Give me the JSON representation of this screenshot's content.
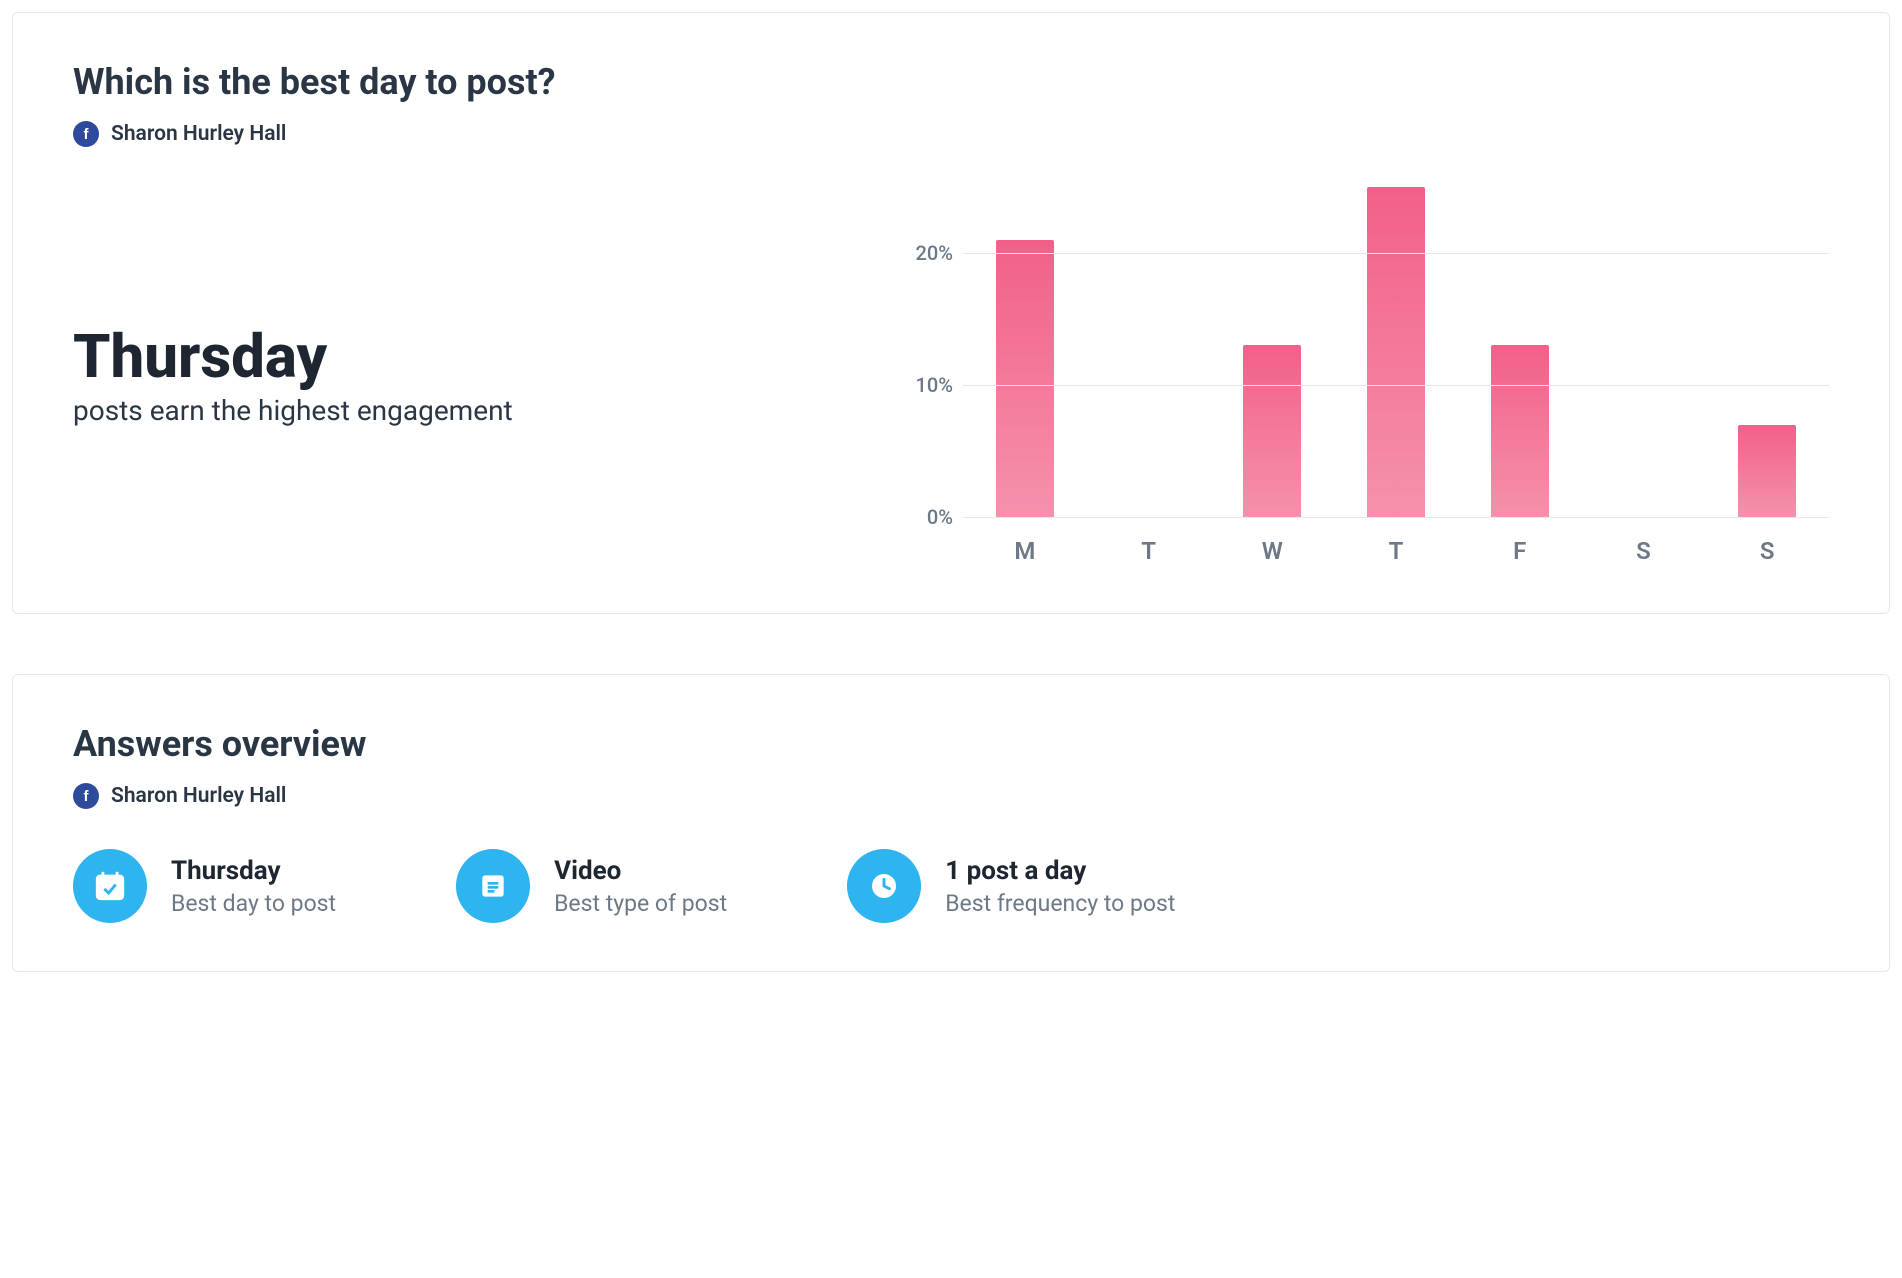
{
  "best_day_card": {
    "title": "Which is the best day to post?",
    "profile_name": "Sharon Hurley Hall",
    "summary_big": "Thursday",
    "summary_sub": "posts earn the highest engagement"
  },
  "answers_card": {
    "title": "Answers overview",
    "profile_name": "Sharon Hurley Hall",
    "items": [
      {
        "title": "Thursday",
        "sub": "Best day to post"
      },
      {
        "title": "Video",
        "sub": "Best type of post"
      },
      {
        "title": "1 post a day",
        "sub": "Best frequency to post"
      }
    ]
  },
  "chart_data": {
    "type": "bar",
    "categories": [
      "M",
      "T",
      "W",
      "T",
      "F",
      "S",
      "S"
    ],
    "values": [
      21,
      0,
      13,
      25,
      13,
      0,
      7
    ],
    "title": "",
    "xlabel": "",
    "ylabel": "",
    "ylim": [
      0,
      25
    ],
    "yticks": [
      0,
      10,
      20
    ],
    "ytick_labels": [
      "0%",
      "10%",
      "20%"
    ]
  }
}
